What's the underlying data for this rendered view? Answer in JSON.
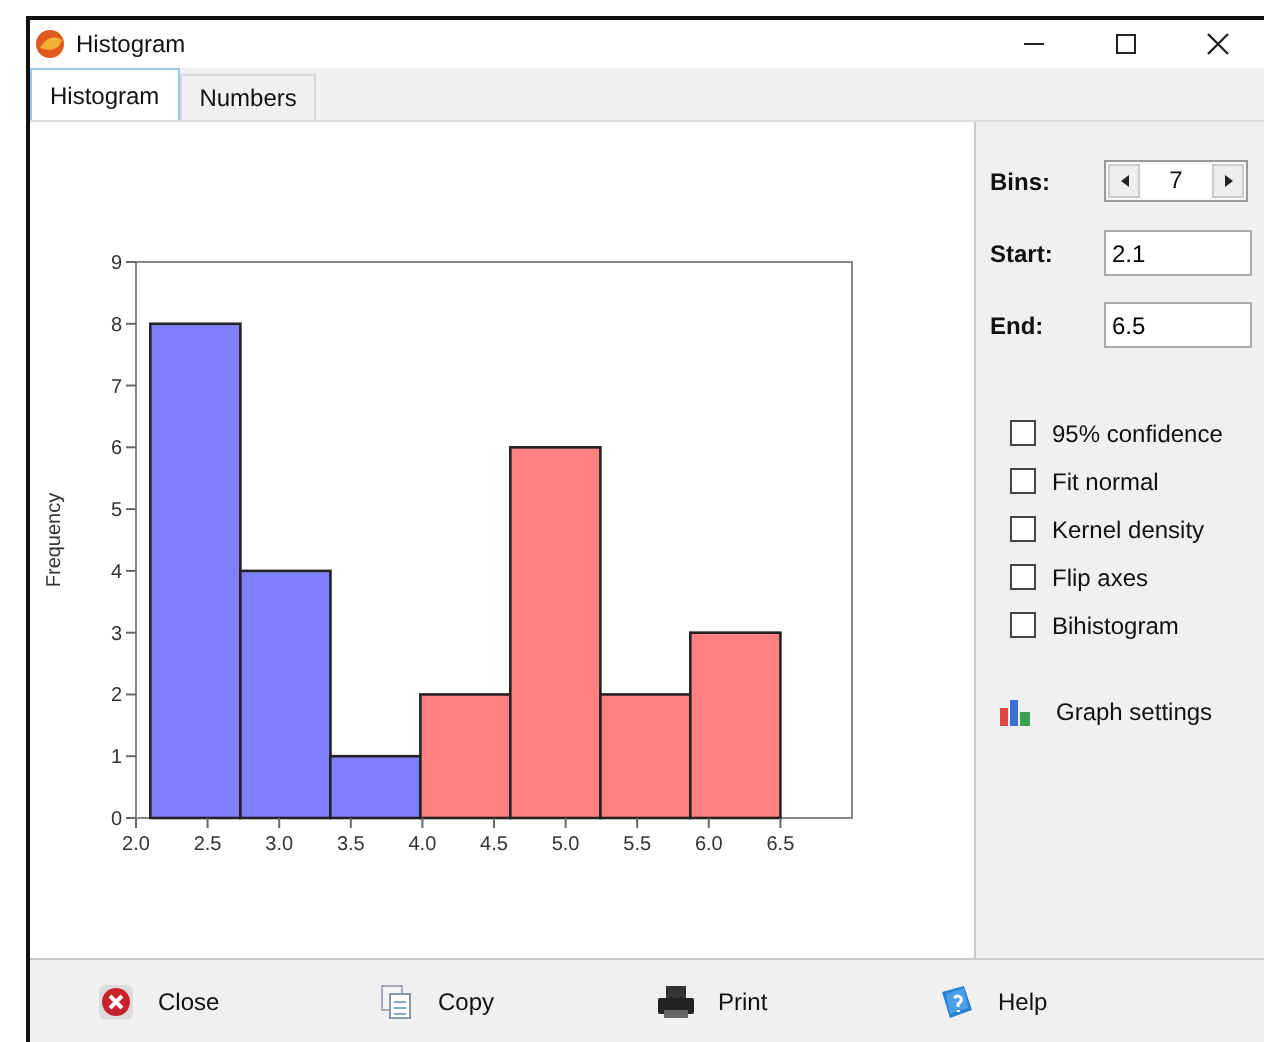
{
  "window": {
    "title": "Histogram"
  },
  "tabs": [
    {
      "label": "Histogram",
      "selected": true
    },
    {
      "label": "Numbers",
      "selected": false
    }
  ],
  "chart": {
    "chart_data": {
      "type": "bar",
      "ylabel": "Frequency",
      "x": [
        2.1,
        2.729,
        3.357,
        3.986,
        4.614,
        5.243,
        5.871
      ],
      "series": [
        {
          "color": "#8080ff",
          "values": [
            8,
            4,
            1,
            null,
            null,
            null,
            null
          ]
        },
        {
          "color": "#ff8080",
          "values": [
            null,
            null,
            null,
            2,
            6,
            2,
            3
          ]
        }
      ],
      "xlim": [
        2.0,
        7.0
      ],
      "ylim": [
        0,
        9
      ],
      "xticks": [
        {
          "value": 2.0,
          "label": "2.0"
        },
        {
          "value": 2.5,
          "label": "2.5"
        },
        {
          "value": 3.0,
          "label": "3.0"
        },
        {
          "value": 3.5,
          "label": "3.5"
        },
        {
          "value": 4.0,
          "label": "4.0"
        },
        {
          "value": 4.5,
          "label": "4.5"
        },
        {
          "value": 5.0,
          "label": "5.0"
        },
        {
          "value": 5.5,
          "label": "5.5"
        },
        {
          "value": 6.0,
          "label": "6.0"
        },
        {
          "value": 6.5,
          "label": "6.5"
        }
      ],
      "yticks": [
        0,
        1,
        2,
        3,
        4,
        5,
        6,
        7,
        8,
        9
      ]
    }
  },
  "settings": {
    "bins": {
      "label": "Bins:",
      "value": "7"
    },
    "start": {
      "label": "Start:",
      "value": "2.1"
    },
    "end": {
      "label": "End:",
      "value": "6.5"
    },
    "options": [
      {
        "label": "95% confidence",
        "checked": false
      },
      {
        "label": "Fit normal",
        "checked": false
      },
      {
        "label": "Kernel density",
        "checked": false
      },
      {
        "label": "Flip axes",
        "checked": false
      },
      {
        "label": "Bihistogram",
        "checked": false
      }
    ],
    "graph_settings": "Graph settings"
  },
  "buttons": [
    {
      "label": "Close",
      "kind": "close"
    },
    {
      "label": "Copy",
      "kind": "copy"
    },
    {
      "label": "Print",
      "kind": "print"
    },
    {
      "label": "Help",
      "kind": "help"
    }
  ]
}
